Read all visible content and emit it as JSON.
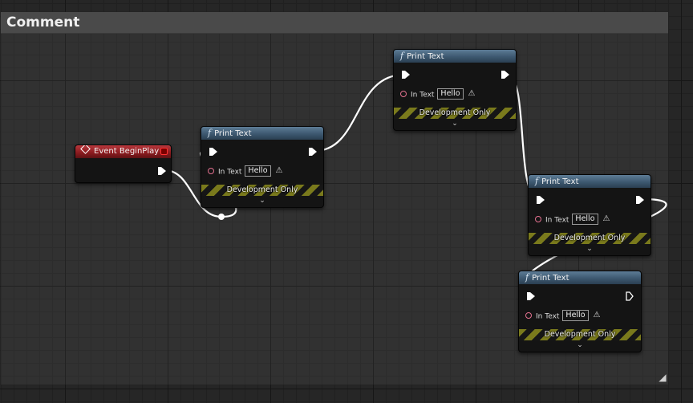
{
  "comment": {
    "title": "Comment",
    "resize_glyph": "◢"
  },
  "nodes": {
    "event_begin_play": {
      "title": "Event BeginPlay",
      "header_color": "#9a2226",
      "icon": "event-diamond-icon"
    },
    "print_text_1": {
      "title": "Print Text",
      "fx_glyph": "f",
      "in_text_label": "In Text",
      "in_text_value": "Hello",
      "warn_glyph": "⚠",
      "dev_label": "Development Only",
      "chevron": "⌄"
    },
    "print_text_2": {
      "title": "Print Text",
      "fx_glyph": "f",
      "in_text_label": "In Text",
      "in_text_value": "Hello",
      "warn_glyph": "⚠",
      "dev_label": "Development Only",
      "chevron": "⌄"
    },
    "print_text_3": {
      "title": "Print Text",
      "fx_glyph": "f",
      "in_text_label": "In Text",
      "in_text_value": "Hello",
      "warn_glyph": "⚠",
      "dev_label": "Development Only",
      "chevron": "⌄"
    },
    "print_text_4": {
      "title": "Print Text",
      "fx_glyph": "f",
      "in_text_label": "In Text",
      "in_text_value": "Hello",
      "warn_glyph": "⚠",
      "dev_label": "Development Only",
      "chevron": "⌄"
    }
  },
  "colors": {
    "function_header": "#3d5870",
    "event_header": "#9a2226",
    "exec_wire": "#ffffff",
    "text_pin": "#e2708f",
    "dev_stripe": "#7a7a1c"
  }
}
